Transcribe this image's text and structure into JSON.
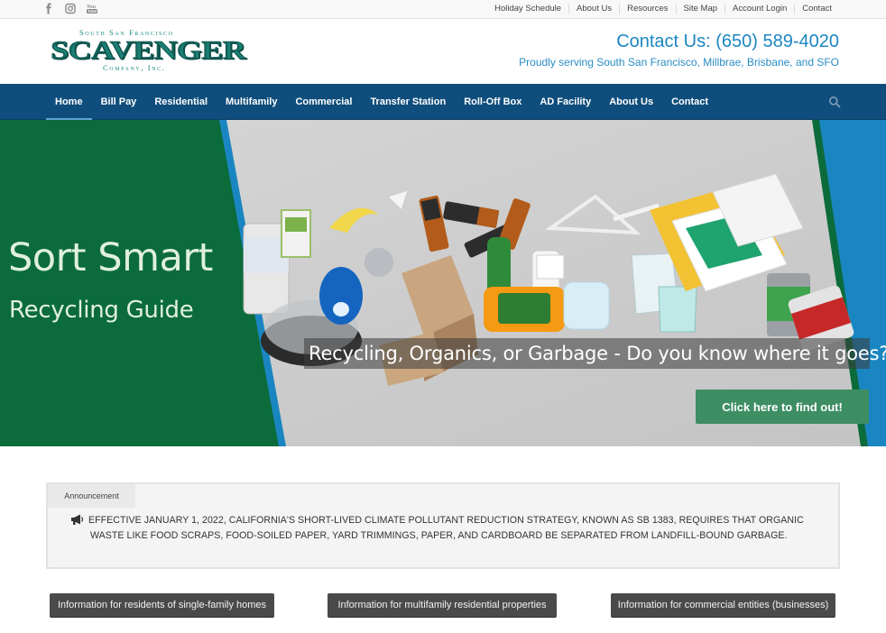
{
  "topbar": {
    "social_icons": [
      "facebook-icon",
      "instagram-icon",
      "youtube-icon"
    ],
    "links": [
      "Holiday Schedule",
      "About Us",
      "Resources",
      "Site Map",
      "Account Login",
      "Contact"
    ]
  },
  "header": {
    "logo": {
      "top_line": "South San Francisco",
      "main_text": "SCAVENGER",
      "bottom_line": "Company, Inc."
    },
    "contact_heading": "Contact Us: (650) 589-4020",
    "service_area": "Proudly serving South San Francisco, Millbrae, Brisbane, and SFO"
  },
  "nav": {
    "items": [
      "Home",
      "Bill Pay",
      "Residential",
      "Multifamily",
      "Commercial",
      "Transfer Station",
      "Roll-Off Box",
      "AD Facility",
      "About Us",
      "Contact"
    ],
    "active": "Home",
    "search_icon": "search-icon"
  },
  "hero": {
    "title": "Sort Smart",
    "subtitle": "Recycling Guide",
    "caption": "Recycling, Organics, or Garbage - Do you know where it goes?",
    "button": "Click here to find out!",
    "colors": {
      "green_panel": "#0b6b3a",
      "blue_stripe": "#1a86c1",
      "button_green": "#3e8e63"
    }
  },
  "announcement": {
    "tab_label": "Announcement",
    "icon": "megaphone-icon",
    "line1": "Effective January 1, 2022, California's Short-Lived Climate Pollutant Reduction Strategy, known as SB 1383, requires that organic",
    "line2": "waste like food scraps, food-soiled paper, yard trimmings, paper, and cardboard be separated from landfill-bound garbage."
  },
  "info_buttons": [
    "Information for residents of single-family homes",
    "Information for multifamily residential properties",
    "Information for commercial entities (businesses)"
  ]
}
